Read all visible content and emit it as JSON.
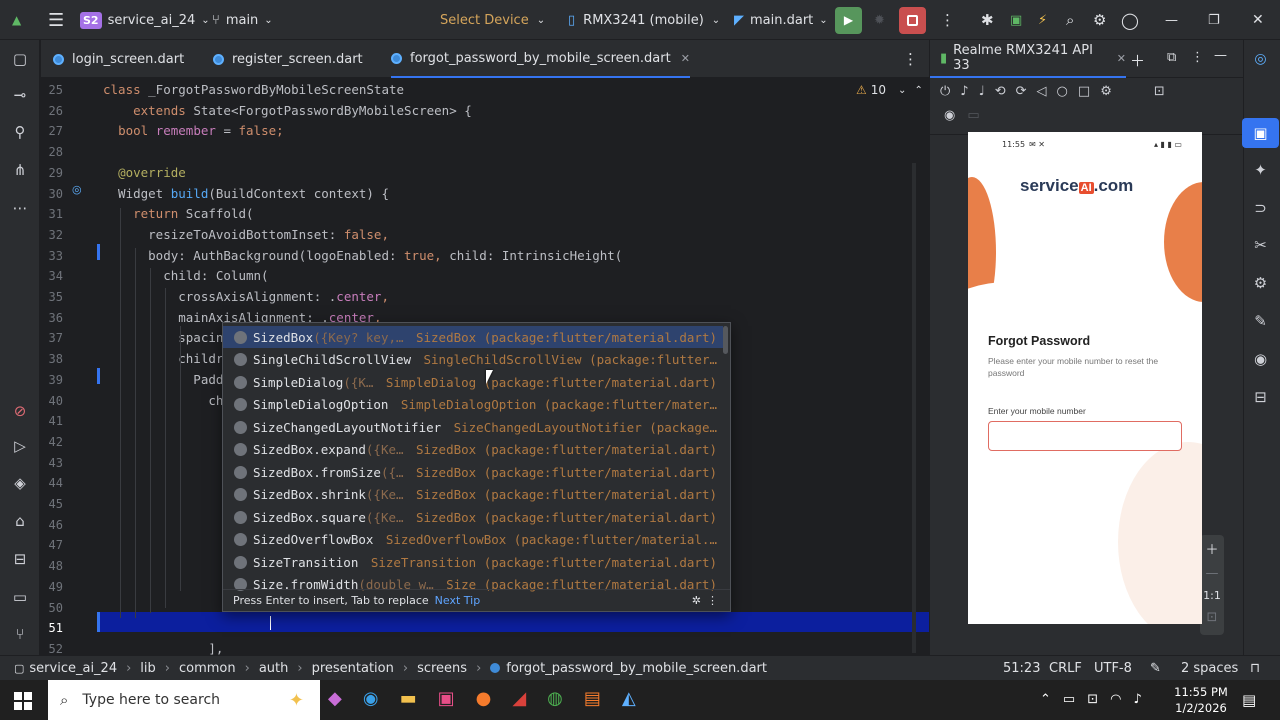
{
  "titlebar": {
    "project_badge": "S2",
    "project_name": "service_ai_24",
    "branch": "main",
    "select_device": "Select Device",
    "device": "RMX3241 (mobile)",
    "run_config": "main.dart"
  },
  "tabs": [
    {
      "label": "login_screen.dart",
      "active": false
    },
    {
      "label": "register_screen.dart",
      "active": false
    },
    {
      "label": "forgot_password_by_mobile_screen.dart",
      "active": true
    }
  ],
  "editor": {
    "warning_count": "10",
    "lines": [
      {
        "n": "25",
        "t": [
          [
            "kw",
            "class "
          ],
          [
            "",
            "_ForgotPasswordByMobileScreenState"
          ]
        ]
      },
      {
        "n": "26",
        "t": [
          [
            "",
            "    "
          ],
          [
            "kw",
            "extends "
          ],
          [
            "",
            "State<ForgotPasswordByMobileScreen> {"
          ]
        ]
      },
      {
        "n": "27",
        "t": [
          [
            "",
            "  "
          ],
          [
            "kw",
            "bool "
          ],
          [
            "pr",
            "remember"
          ],
          [
            "",
            " = "
          ],
          [
            "kw",
            "false"
          ],
          [
            "kw",
            ";"
          ]
        ]
      },
      {
        "n": "28",
        "t": [
          [
            "",
            ""
          ]
        ]
      },
      {
        "n": "29",
        "t": [
          [
            "",
            "  "
          ],
          [
            "an",
            "@override"
          ]
        ]
      },
      {
        "n": "30",
        "t": [
          [
            "",
            "  Widget "
          ],
          [
            "fn",
            "build"
          ],
          [
            "",
            "(BuildContext context) {"
          ]
        ]
      },
      {
        "n": "31",
        "t": [
          [
            "",
            "    "
          ],
          [
            "kw",
            "return "
          ],
          [
            "",
            "Scaffold("
          ]
        ]
      },
      {
        "n": "32",
        "t": [
          [
            "",
            "      resizeToAvoidBottomInset: "
          ],
          [
            "kw",
            "false"
          ],
          [
            "kw",
            ","
          ]
        ]
      },
      {
        "n": "33",
        "t": [
          [
            "",
            "      body: AuthBackground(logoEnabled: "
          ],
          [
            "kw",
            "true"
          ],
          [
            "kw",
            ", "
          ],
          [
            "",
            "child: IntrinsicHeight("
          ]
        ]
      },
      {
        "n": "34",
        "t": [
          [
            "",
            "        child: Column("
          ]
        ]
      },
      {
        "n": "35",
        "t": [
          [
            "",
            "          crossAxisAlignment: ."
          ],
          [
            "pr",
            "center"
          ],
          [
            "kw",
            ","
          ]
        ]
      },
      {
        "n": "36",
        "t": [
          [
            "",
            "          mainAxisAlignment: ."
          ],
          [
            "pr",
            "center"
          ],
          [
            "kw",
            ","
          ]
        ]
      },
      {
        "n": "37",
        "t": [
          [
            "",
            "          spacin"
          ]
        ]
      },
      {
        "n": "38",
        "t": [
          [
            "",
            "          childr"
          ]
        ]
      },
      {
        "n": "39",
        "t": [
          [
            "",
            "            Padd"
          ]
        ]
      },
      {
        "n": "40",
        "t": [
          [
            "",
            "              ch"
          ]
        ]
      },
      {
        "n": "41",
        "t": [
          [
            "",
            ""
          ]
        ]
      },
      {
        "n": "42",
        "t": [
          [
            "",
            ""
          ]
        ]
      },
      {
        "n": "43",
        "t": [
          [
            "",
            ""
          ]
        ]
      },
      {
        "n": "44",
        "t": [
          [
            "",
            ""
          ]
        ]
      },
      {
        "n": "45",
        "t": [
          [
            "",
            ""
          ]
        ]
      },
      {
        "n": "46",
        "t": [
          [
            "",
            ""
          ]
        ]
      },
      {
        "n": "47",
        "t": [
          [
            "",
            "                                                          "
          ],
          [
            "st",
            "sword'"
          ],
          [
            "",
            "),"
          ]
        ]
      },
      {
        "n": "48",
        "t": [
          [
            "",
            ""
          ]
        ]
      },
      {
        "n": "49",
        "t": [
          [
            "",
            ""
          ]
        ]
      },
      {
        "n": "50",
        "t": [
          [
            "",
            ""
          ]
        ]
      },
      {
        "n": "51",
        "t": [
          [
            "",
            "                Si"
          ]
        ]
      },
      {
        "n": "52",
        "t": [
          [
            "",
            "              ],"
          ]
        ]
      }
    ]
  },
  "completion": {
    "items": [
      {
        "name": "SizedBox",
        "args": "({Key? key,…",
        "pkg": "SizedBox (package:flutter/material.dart)"
      },
      {
        "name": "SingleChildScrollView",
        "args": "",
        "pkg": "SingleChildScrollView (package:flutter…"
      },
      {
        "name": "SimpleDialog",
        "args": "({K…",
        "pkg": "SimpleDialog (package:flutter/material.dart)"
      },
      {
        "name": "SimpleDialogOption",
        "args": "",
        "pkg": "SimpleDialogOption (package:flutter/mater…"
      },
      {
        "name": "SizeChangedLayoutNotifier",
        "args": "",
        "pkg": "SizeChangedLayoutNotifier (package…"
      },
      {
        "name": "SizedBox.expand",
        "args": "({Ke…",
        "pkg": "SizedBox (package:flutter/material.dart)"
      },
      {
        "name": "SizedBox.fromSize",
        "args": "({…",
        "pkg": "SizedBox (package:flutter/material.dart)"
      },
      {
        "name": "SizedBox.shrink",
        "args": "({Ke…",
        "pkg": "SizedBox (package:flutter/material.dart)"
      },
      {
        "name": "SizedBox.square",
        "args": "({Ke…",
        "pkg": "SizedBox (package:flutter/material.dart)"
      },
      {
        "name": "SizedOverflowBox",
        "args": "",
        "pkg": "SizedOverflowBox (package:flutter/material.…"
      },
      {
        "name": "SizeTransition",
        "args": "",
        "pkg": "SizeTransition (package:flutter/material.dart)"
      },
      {
        "name": "Size.fromWidth",
        "args": "(double w…",
        "pkg": "Size (package:flutter/material.dart)"
      }
    ],
    "hint": "Press Enter to insert, Tab to replace",
    "next_tip": "Next Tip"
  },
  "emulator": {
    "tab_title": "Realme RMX3241 API 33",
    "zoom_ratio": "1:1",
    "phone": {
      "time": "11:55",
      "brand_prefix": "service",
      "brand_mid": "AI",
      "brand_suffix": ".com",
      "heading": "Forgot Password",
      "subtitle": "Please enter your mobile number to reset the password",
      "field_label": "Enter your mobile number"
    }
  },
  "statusbar": {
    "crumbs": [
      "service_ai_24",
      "lib",
      "common",
      "auth",
      "presentation",
      "screens",
      "forgot_password_by_mobile_screen.dart"
    ],
    "position": "51:23",
    "line_sep": "CRLF",
    "encoding": "UTF-8",
    "indent": "2 spaces"
  },
  "taskbar": {
    "search_placeholder": "Type here to search",
    "time": "11:55 PM",
    "date": "1/2/2026"
  }
}
